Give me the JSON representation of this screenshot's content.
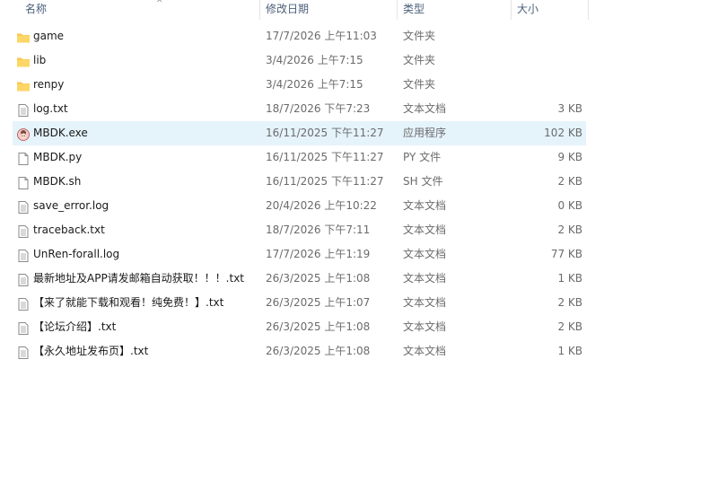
{
  "columns": {
    "name": "名称",
    "date": "修改日期",
    "type": "类型",
    "size": "大小"
  },
  "sort_indicator": "^",
  "files": [
    {
      "name": "game",
      "date": "17/7/2026 上午11:03",
      "type": "文件夹",
      "size": "",
      "icon": "folder-icon"
    },
    {
      "name": "lib",
      "date": "3/4/2026 上午7:15",
      "type": "文件夹",
      "size": "",
      "icon": "folder-icon"
    },
    {
      "name": "renpy",
      "date": "3/4/2026 上午7:15",
      "type": "文件夹",
      "size": "",
      "icon": "folder-icon"
    },
    {
      "name": "log.txt",
      "date": "18/7/2026 下午7:23",
      "type": "文本文档",
      "size": "3 KB",
      "icon": "text-file-icon"
    },
    {
      "name": "MBDK.exe",
      "date": "16/11/2025 下午11:27",
      "type": "应用程序",
      "size": "102 KB",
      "icon": "app-icon",
      "selected": true
    },
    {
      "name": "MBDK.py",
      "date": "16/11/2025 下午11:27",
      "type": "PY 文件",
      "size": "9 KB",
      "icon": "blank-file-icon"
    },
    {
      "name": "MBDK.sh",
      "date": "16/11/2025 下午11:27",
      "type": "SH 文件",
      "size": "2 KB",
      "icon": "blank-file-icon"
    },
    {
      "name": "save_error.log",
      "date": "20/4/2026 上午10:22",
      "type": "文本文档",
      "size": "0 KB",
      "icon": "text-file-icon"
    },
    {
      "name": "traceback.txt",
      "date": "18/7/2026 下午7:11",
      "type": "文本文档",
      "size": "2 KB",
      "icon": "text-file-icon"
    },
    {
      "name": "UnRen-forall.log",
      "date": "17/7/2026 上午1:19",
      "type": "文本文档",
      "size": "77 KB",
      "icon": "text-file-icon"
    },
    {
      "name": "最新地址及APP请发邮箱自动获取！！！.txt",
      "date": "26/3/2025 上午1:08",
      "type": "文本文档",
      "size": "1 KB",
      "icon": "text-file-icon"
    },
    {
      "name": "【来了就能下载和观看！纯免费！】.txt",
      "date": "26/3/2025 上午1:07",
      "type": "文本文档",
      "size": "2 KB",
      "icon": "text-file-icon"
    },
    {
      "name": "【论坛介绍】.txt",
      "date": "26/3/2025 上午1:08",
      "type": "文本文档",
      "size": "2 KB",
      "icon": "text-file-icon"
    },
    {
      "name": "【永久地址发布页】.txt",
      "date": "26/3/2025 上午1:08",
      "type": "文本文档",
      "size": "1 KB",
      "icon": "text-file-icon"
    }
  ],
  "colors": {
    "selected_row": "#e5f3fb",
    "header_text": "#4c607a",
    "folder": "#f8c44f"
  }
}
